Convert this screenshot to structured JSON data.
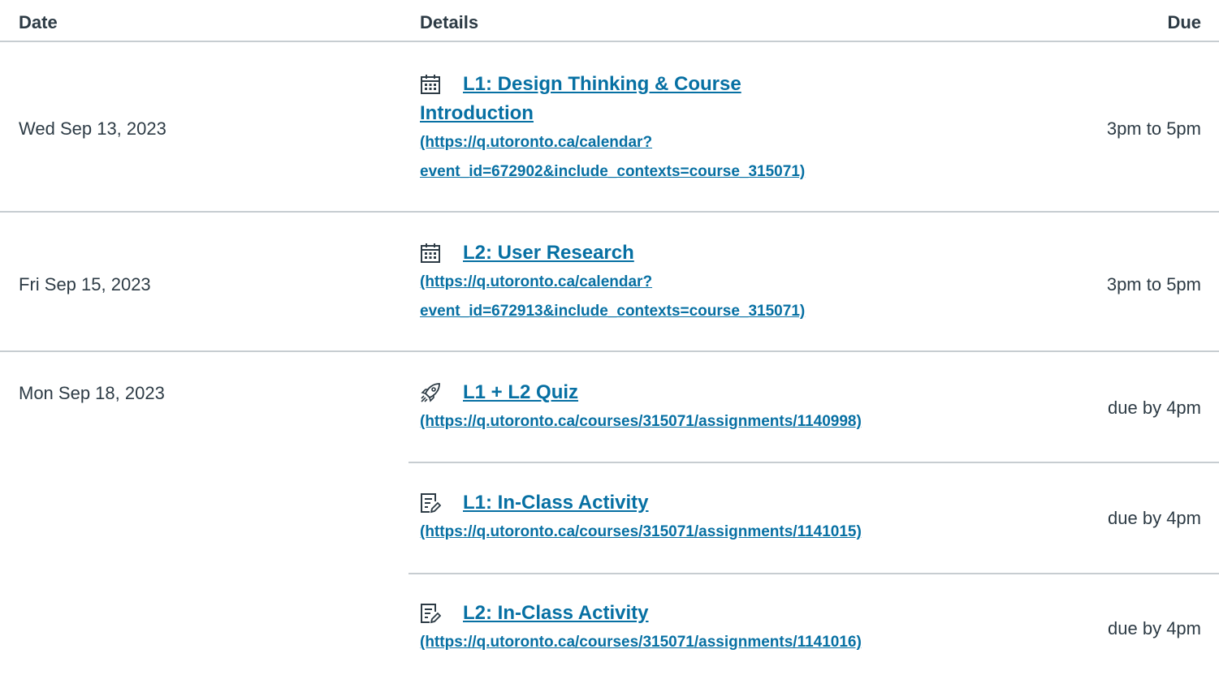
{
  "header": {
    "date": "Date",
    "details": "Details",
    "due": "Due"
  },
  "rows": [
    {
      "date": "Wed Sep 13, 2023",
      "icon": "calendar-icon",
      "title": "L1: Design Thinking & Course Introduction",
      "url_line1": "(https://q.utoronto.ca/calendar?",
      "url_line2": "event_id=672902&include_contexts=course_315071)",
      "due": "3pm to 5pm"
    },
    {
      "date": "Fri Sep 15, 2023",
      "icon": "calendar-icon",
      "title": "L2: User Research",
      "url_line1": "(https://q.utoronto.ca/calendar?",
      "url_line2": "event_id=672913&include_contexts=course_315071)",
      "due": "3pm to 5pm"
    },
    {
      "date": "Mon Sep 18, 2023",
      "icon": "rocket-icon",
      "title": "L1 + L2 Quiz",
      "url_line1": "(https://q.utoronto.ca/courses/315071/assignments/1140998)",
      "due": "due by 4pm"
    },
    {
      "date": "",
      "icon": "assignment-icon",
      "title": "L1: In-Class Activity",
      "url_line1": "(https://q.utoronto.ca/courses/315071/assignments/1141015)",
      "due": "due by 4pm"
    },
    {
      "date": "",
      "icon": "assignment-icon",
      "title": "L2: In-Class Activity",
      "url_line1": "(https://q.utoronto.ca/courses/315071/assignments/1141016)",
      "due": "due by 4pm"
    }
  ],
  "colors": {
    "link": "#0770a3",
    "text": "#2d3b45",
    "divider": "#c7cdd1"
  }
}
